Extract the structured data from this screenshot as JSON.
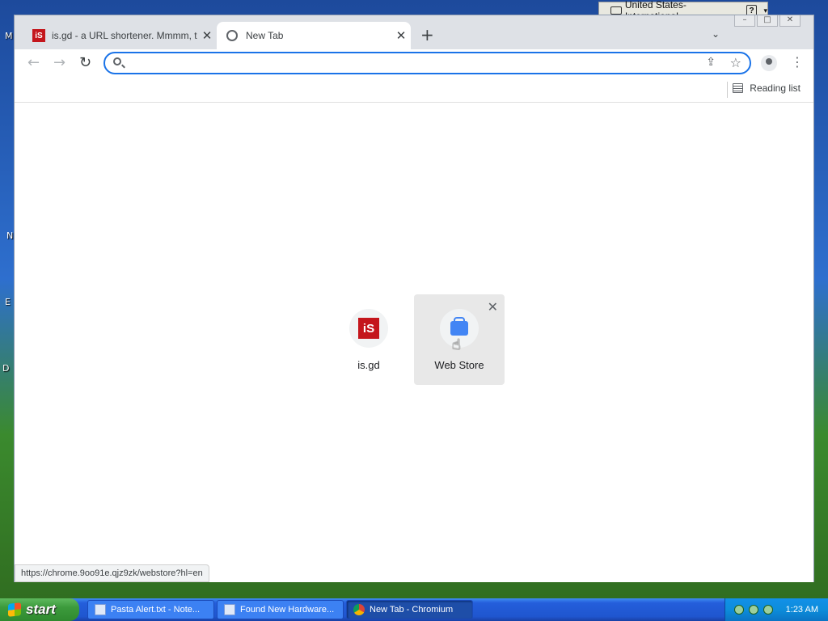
{
  "language_bar": {
    "label": "United States-International",
    "help": "?"
  },
  "browser": {
    "tabs": [
      {
        "title": "is.gd - a URL shortener. Mmmm, ta",
        "favicon": "iS"
      },
      {
        "title": "New Tab"
      }
    ],
    "new_tab_symbol": "+",
    "omnibox": {
      "value": ""
    },
    "reading_list_label": "Reading list",
    "shortcuts": [
      {
        "label": "is.gd",
        "logo_text": "iS"
      },
      {
        "label": "Web Store"
      }
    ],
    "status_url": "https://chrome.9oo91e.qjz9zk/webstore?hl=en"
  },
  "taskbar": {
    "start_label": "start",
    "tasks": [
      {
        "label": "Pasta Alert.txt - Note..."
      },
      {
        "label": "Found New Hardware..."
      },
      {
        "label": "New Tab - Chromium"
      }
    ],
    "clock": "1:23 AM"
  },
  "colors": {
    "accent": "#1a73e8",
    "isgd_brand": "#c4161c",
    "taskbar_blue": "#245edb"
  }
}
